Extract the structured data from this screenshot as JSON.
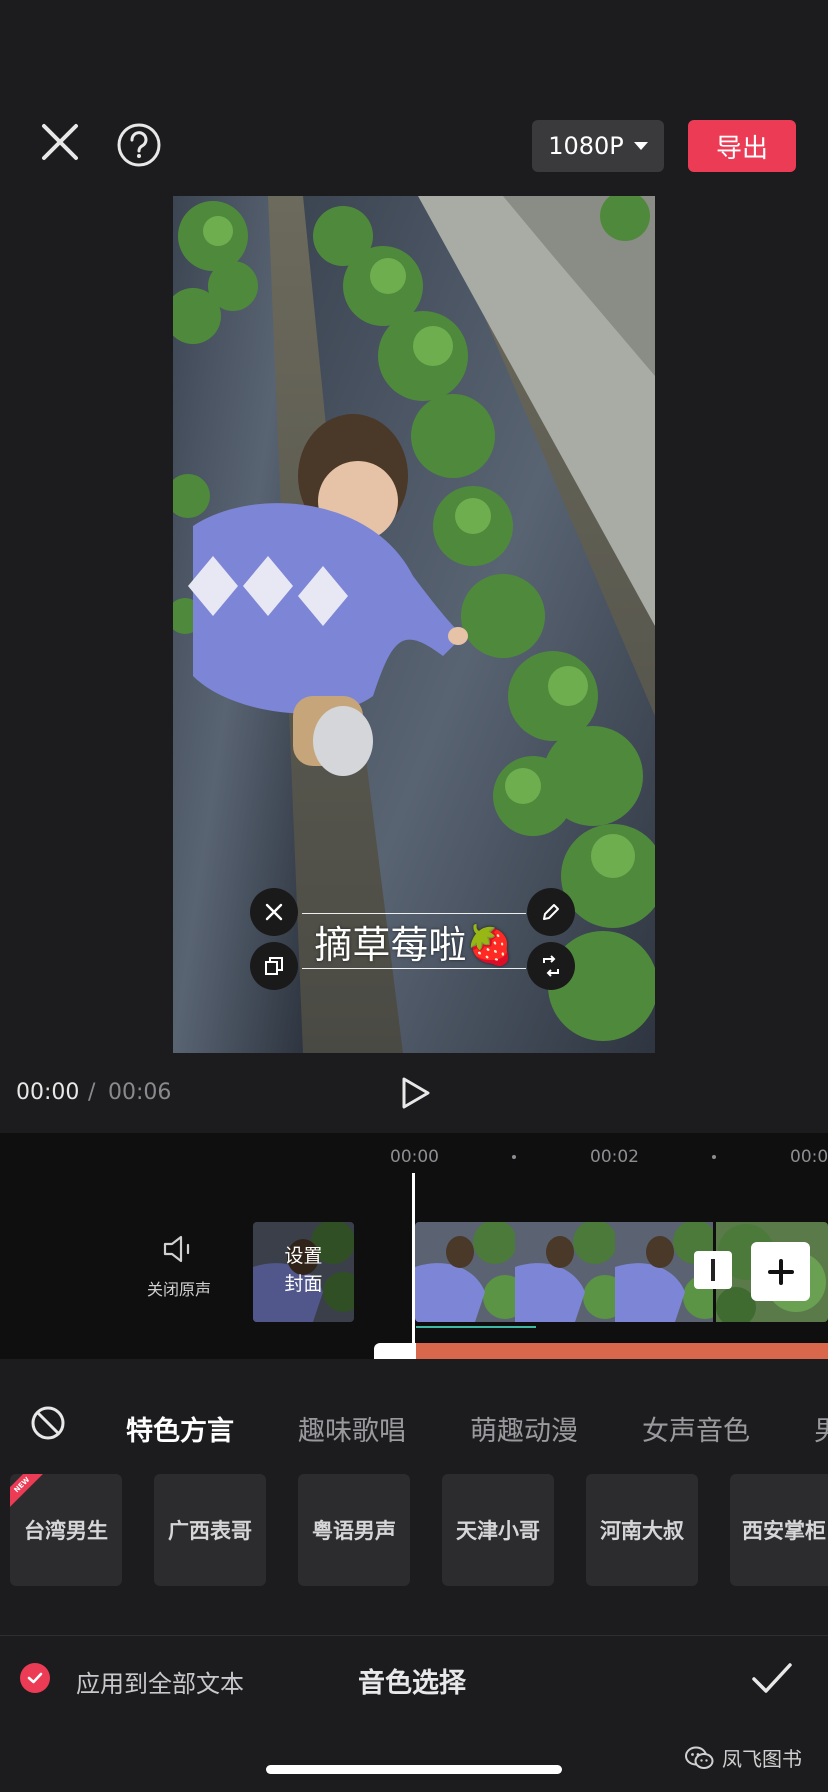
{
  "toolbar": {
    "resolution_label": "1080P",
    "export_label": "导出"
  },
  "preview": {
    "caption_text": "摘草莓啦🍓"
  },
  "playback": {
    "current_time": "00:00",
    "separator": "/",
    "total_time": "00:06"
  },
  "timeline": {
    "ruler": [
      "00:00",
      "00:02",
      "00:0"
    ],
    "mute_label": "关闭原声",
    "cover_label_line1": "设置",
    "cover_label_line2": "封面"
  },
  "voice_panel": {
    "categories": [
      {
        "label": "特色方言",
        "active": true
      },
      {
        "label": "趣味歌唱",
        "active": false
      },
      {
        "label": "萌趣动漫",
        "active": false
      },
      {
        "label": "女声音色",
        "active": false
      },
      {
        "label": "男",
        "active": false
      }
    ],
    "voices": [
      {
        "label": "台湾男生",
        "badge": "NEW"
      },
      {
        "label": "广西表哥"
      },
      {
        "label": "粤语男声"
      },
      {
        "label": "天津小哥"
      },
      {
        "label": "河南大叔"
      },
      {
        "label": "西安掌柜"
      }
    ],
    "apply_all_label": "应用到全部文本",
    "apply_all_checked": true,
    "title": "音色选择"
  },
  "watermark": "凤飞图书",
  "colors": {
    "accent": "#ec3b55",
    "background": "#1c1c1e",
    "timeline_bg": "#0f0f10",
    "track_bar": "#d9674c"
  }
}
